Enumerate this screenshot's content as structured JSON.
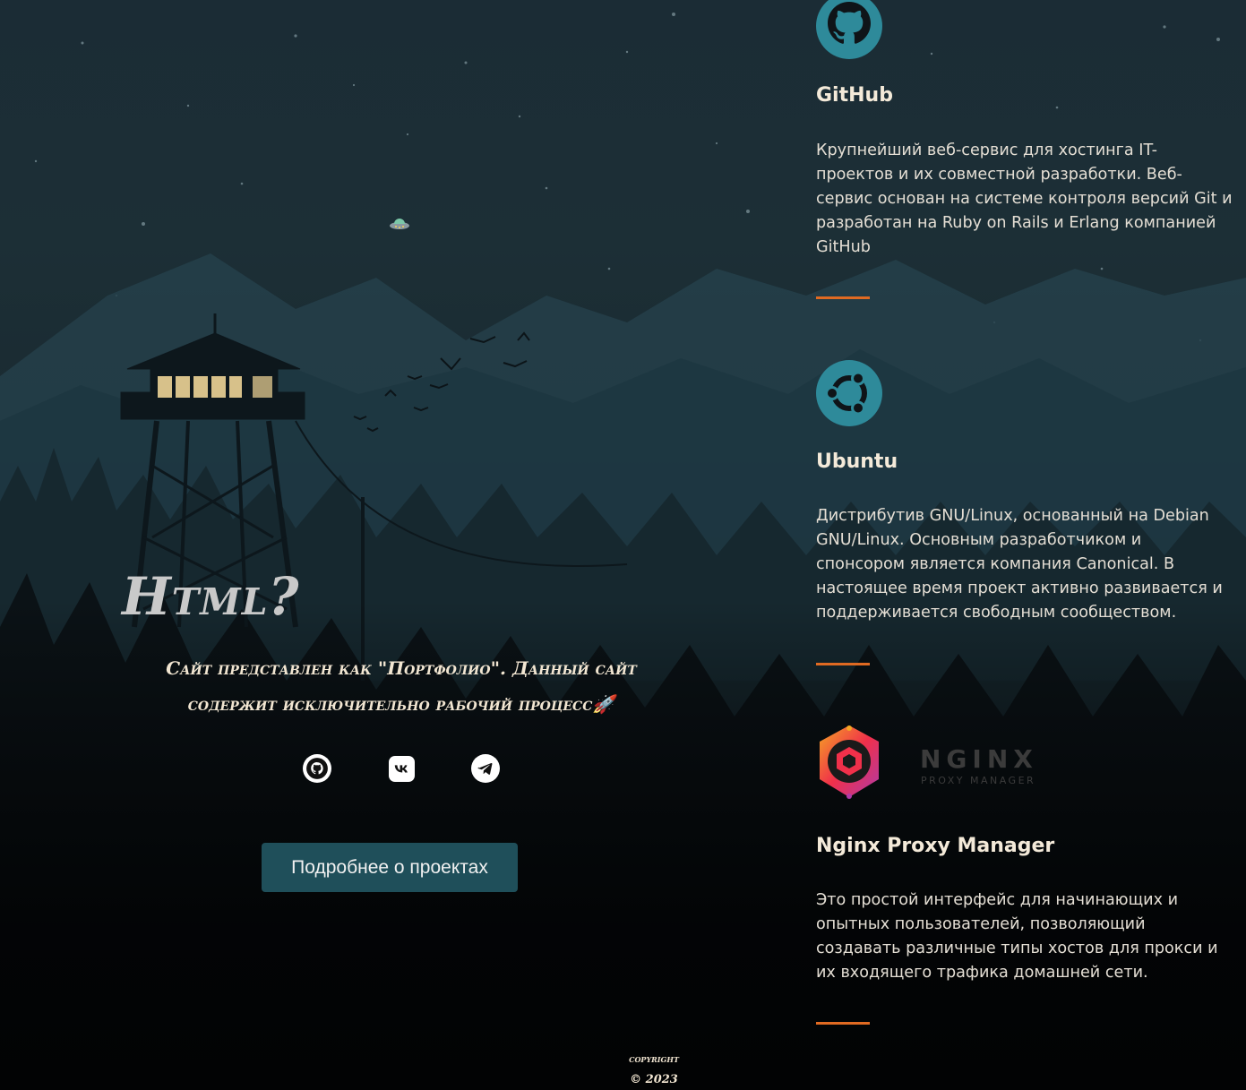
{
  "hero": {
    "title": "Html?",
    "subtitle": "Сайт представлен как \"Портфолио\". Данный сайт содержит исключительно рабочий процесс🚀",
    "cta_label": "Подробнее о проектах"
  },
  "social_links": [
    {
      "name": "github",
      "icon": "github-icon"
    },
    {
      "name": "vk",
      "icon": "vk-icon"
    },
    {
      "name": "telegram",
      "icon": "telegram-icon"
    }
  ],
  "projects": [
    {
      "title": "GitHub",
      "icon": "github-logo-icon",
      "description": "Крупнейший веб-сервис для хостинга IT-проектов и их совместной разработки. Веб-сервис основан на системе контроля версий Git и разработан на Ruby on Rails и Erlang компанией GitHub"
    },
    {
      "title": "Ubuntu",
      "icon": "ubuntu-logo-icon",
      "description": "Дистрибутив GNU/Linux, основанный на Debian GNU/Linux. Основным разработчиком и спонсором является компания Canonical. В настоящее время проект активно развивается и поддерживается свободным сообществом."
    },
    {
      "title": "Nginx Proxy Manager",
      "icon": "nginx-proxy-manager-logo-icon",
      "logo_text": "NGINX",
      "logo_subtext": "PROXY MANAGER",
      "description": "Это простой интерфейс для начинающих и опытных пользователей, позволяющий создавать различные типы хостов для прокси и их входящего трафика домашней сети."
    }
  ],
  "footer": {
    "copyright_label": "copyright",
    "year": "© 2023"
  },
  "colors": {
    "accent": "#e06a22",
    "icon_teal": "#2e8a9a",
    "button": "#1f4f5a"
  }
}
